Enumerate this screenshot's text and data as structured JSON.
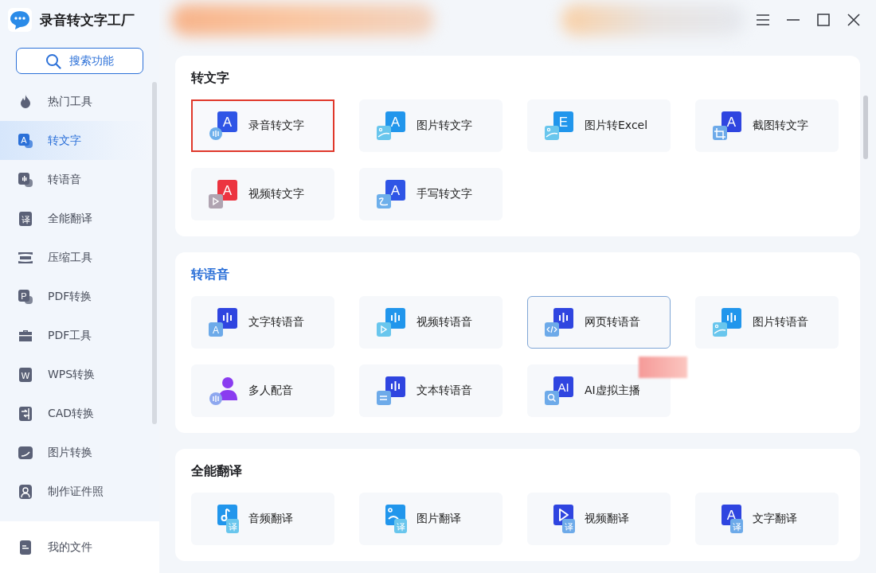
{
  "app": {
    "title": "录音转文字工厂"
  },
  "search": {
    "label": "搜索功能"
  },
  "sidebar": {
    "items": [
      {
        "label": "热门工具",
        "selected": false
      },
      {
        "label": "转文字",
        "glyph": "A",
        "selected": true
      },
      {
        "label": "转语音",
        "selected": false
      },
      {
        "label": "全能翻译",
        "glyph": "译",
        "selected": false
      },
      {
        "label": "压缩工具",
        "selected": false
      },
      {
        "label": "PDF转换",
        "glyph": "P",
        "selected": false
      },
      {
        "label": "PDF工具",
        "selected": false
      },
      {
        "label": "WPS转换",
        "glyph": "W",
        "selected": false
      },
      {
        "label": "CAD转换",
        "selected": false
      },
      {
        "label": "图片转换",
        "selected": false
      },
      {
        "label": "制作证件照",
        "selected": false
      }
    ],
    "footer": {
      "label": "我的文件"
    }
  },
  "sections": [
    {
      "title": "转文字",
      "active": false,
      "tiles": [
        {
          "label": "录音转文字",
          "icon": {
            "glyph": "A",
            "color": "#2f55e6"
          },
          "highlighted": true,
          "hovered": false
        },
        {
          "label": "图片转文字",
          "icon": {
            "glyph": "A",
            "color": "#2196ec"
          },
          "highlighted": false,
          "hovered": false
        },
        {
          "label": "图片转Excel",
          "icon": {
            "glyph": "E",
            "color": "#2196ec"
          },
          "highlighted": false,
          "hovered": false
        },
        {
          "label": "截图转文字",
          "icon": {
            "glyph": "A",
            "color": "#2f45e0"
          },
          "highlighted": false,
          "hovered": false
        },
        {
          "label": "视频转文字",
          "icon": {
            "glyph": "A",
            "color": "#ec3440"
          },
          "highlighted": false,
          "hovered": false
        },
        {
          "label": "手写转文字",
          "icon": {
            "glyph": "A",
            "color": "#2f55e6"
          },
          "highlighted": false,
          "hovered": false
        }
      ]
    },
    {
      "title": "转语音",
      "active": true,
      "tiles": [
        {
          "label": "文字转语音",
          "icon": {
            "sub_glyph": "A",
            "color": "#2f45e0"
          },
          "highlighted": false,
          "hovered": false
        },
        {
          "label": "视频转语音",
          "icon": {
            "color": "#2196ec"
          },
          "highlighted": false,
          "hovered": false
        },
        {
          "label": "网页转语音",
          "icon": {
            "color": "#2f45e0"
          },
          "highlighted": false,
          "hovered": true
        },
        {
          "label": "图片转语音",
          "icon": {
            "color": "#2196ec"
          },
          "highlighted": false,
          "hovered": false
        },
        {
          "label": "多人配音",
          "icon": {
            "color": "#8a3cf0"
          },
          "highlighted": false,
          "hovered": false
        },
        {
          "label": "文本转语音",
          "icon": {
            "color": "#2f45e0"
          },
          "highlighted": false,
          "hovered": false
        },
        {
          "label": "AI虚拟主播",
          "icon": {
            "glyph": "AI",
            "color": "#2f45e0"
          },
          "highlighted": false,
          "hovered": false,
          "has_blurred_badge": true
        }
      ]
    },
    {
      "title": "全能翻译",
      "active": false,
      "tiles": [
        {
          "label": "音频翻译",
          "icon": {
            "sub_glyph": "译",
            "color": "#2196ec"
          },
          "highlighted": false,
          "hovered": false
        },
        {
          "label": "图片翻译",
          "icon": {
            "sub_glyph": "译",
            "color": "#2196ec"
          },
          "highlighted": false,
          "hovered": false
        },
        {
          "label": "视频翻译",
          "icon": {
            "sub_glyph": "译",
            "color": "#2f45e0"
          },
          "highlighted": false,
          "hovered": false
        },
        {
          "label": "文字翻译",
          "icon": {
            "glyph": "A",
            "sub_glyph": "译",
            "color": "#2f45e0"
          },
          "highlighted": false,
          "hovered": false
        }
      ]
    }
  ]
}
